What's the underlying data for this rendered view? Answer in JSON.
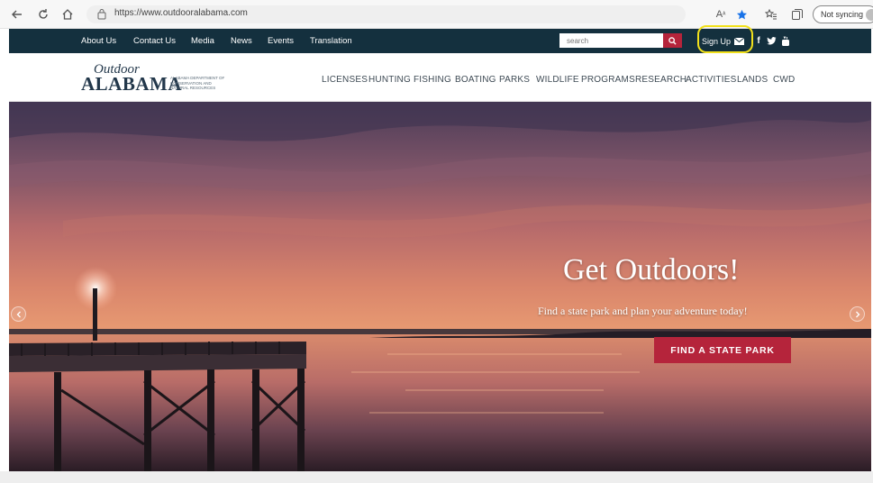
{
  "browser": {
    "url": "https://www.outdooralabama.com",
    "sync_label": "Not syncing"
  },
  "topbar": {
    "links": [
      "About Us",
      "Contact Us",
      "Media",
      "News",
      "Events",
      "Translation"
    ],
    "search_placeholder": "search",
    "signup_label": "Sign Up"
  },
  "header": {
    "logo_outdoor": "Outdoor",
    "logo_alabama": "ALABAMA",
    "logo_dept": "Alabama Department of Conservation and Natural Resources",
    "nav": [
      "LICENSES",
      "HUNTING",
      "FISHING",
      "BOATING",
      "PARKS",
      "WILDLIFE",
      "PROGRAMS",
      "RESEARCH",
      "ACTIVITIES",
      "LANDS",
      "CWD"
    ]
  },
  "hero": {
    "title": "Get Outdoors!",
    "subtitle": "Find a state park and plan your adventure today!",
    "cta_label": "FIND A STATE PARK"
  },
  "colors": {
    "topbar_bg": "#14303e",
    "accent_red": "#b5243b",
    "highlight_yellow": "#f2e11b",
    "favorite_star": "#1a73e8"
  },
  "icons": [
    "back-arrow-icon",
    "refresh-icon",
    "home-icon",
    "lock-icon",
    "read-aloud-icon",
    "favorite-star-icon",
    "favorites-icon",
    "collections-icon",
    "profile-avatar-icon",
    "search-icon",
    "mail-icon",
    "facebook-icon",
    "twitter-icon",
    "youtube-icon",
    "chevron-left-icon",
    "chevron-right-icon"
  ]
}
